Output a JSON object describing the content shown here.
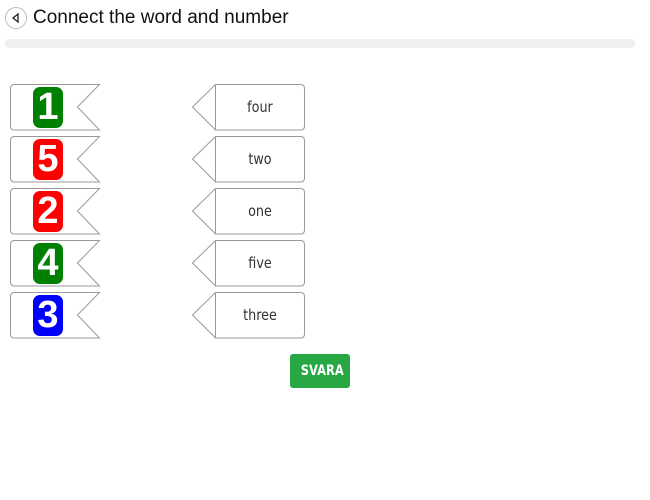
{
  "header": {
    "title": "Connect the word and number",
    "back_icon": "back-arrow-icon"
  },
  "progress": {
    "value": 0
  },
  "numbers": [
    {
      "label": "1",
      "color": "#008000"
    },
    {
      "label": "5",
      "color": "#ff0000"
    },
    {
      "label": "2",
      "color": "#ff0000"
    },
    {
      "label": "4",
      "color": "#008000"
    },
    {
      "label": "3",
      "color": "#0000ff"
    }
  ],
  "words": [
    {
      "label": "four"
    },
    {
      "label": "two"
    },
    {
      "label": "one"
    },
    {
      "label": "five"
    },
    {
      "label": "three"
    }
  ],
  "submit": {
    "label": "SVARA",
    "color": "#28a745"
  }
}
